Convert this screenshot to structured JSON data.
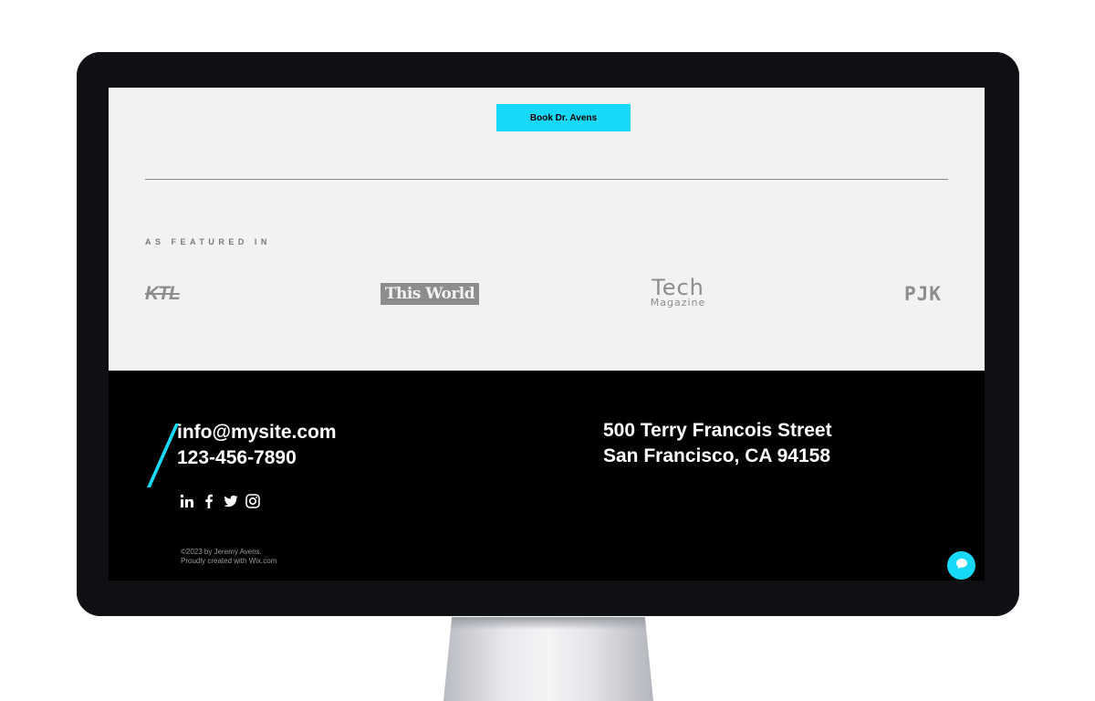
{
  "hero": {
    "book_button_label": "Book Dr. Avens"
  },
  "featured": {
    "heading": "AS FEATURED IN",
    "logos": [
      {
        "name": "KTL"
      },
      {
        "name": "This World"
      },
      {
        "name": "Tech",
        "subtitle": "Magazine"
      },
      {
        "name": "PJK"
      }
    ]
  },
  "footer": {
    "email": "info@mysite.com",
    "phone": "123-456-7890",
    "address_line1": "500 Terry Francois Street",
    "address_line2": "San Francisco, CA 94158",
    "social_icons": [
      "linkedin-icon",
      "facebook-icon",
      "twitter-icon",
      "instagram-icon"
    ],
    "copyright_line1": "©2023 by Jeremy Avens.",
    "copyright_line2": "Proudly created with Wix.com"
  },
  "colors": {
    "accent": "#17d9f7",
    "footer_bg": "#000000",
    "section_bg": "#f2f2f2",
    "logo_gray": "#8d8d8d"
  },
  "chat": {
    "icon": "chat-bubble-icon"
  }
}
